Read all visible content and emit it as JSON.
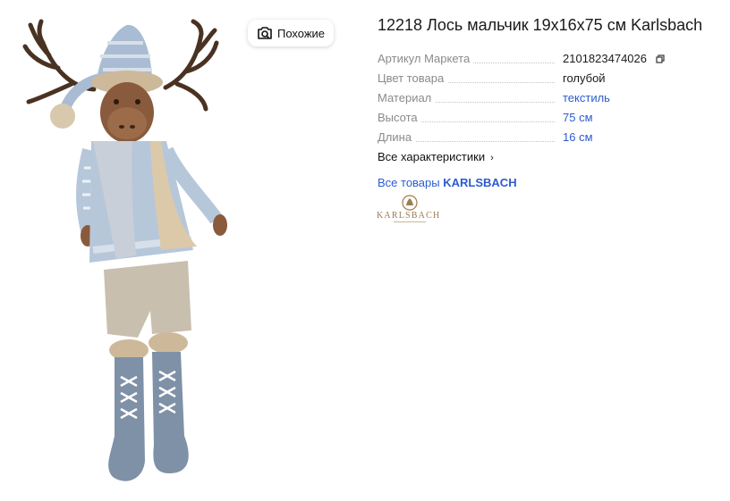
{
  "product": {
    "title": "12218 Лось мальчик 19x16x75 см Karlsbach",
    "image_alt": "moose-boy-toy"
  },
  "similar_button": {
    "label": "Похожие",
    "icon": "camera-search-icon"
  },
  "specs": [
    {
      "name": "Артикул Маркета",
      "value": "2101823474026",
      "link": false,
      "copy": true
    },
    {
      "name": "Цвет товара",
      "value": "голубой",
      "link": false,
      "copy": false
    },
    {
      "name": "Материал",
      "value": "текстиль",
      "link": true,
      "copy": false
    },
    {
      "name": "Высота",
      "value": "75 см",
      "link": true,
      "copy": false
    },
    {
      "name": "Длина",
      "value": "16 см",
      "link": true,
      "copy": false
    }
  ],
  "all_specs": {
    "label": "Все характеристики",
    "icon": "chevron-right-icon"
  },
  "all_goods": {
    "prefix": "Все товары",
    "brand": "KARLSBACH"
  },
  "brand_logo": {
    "text": "KARLSBACH",
    "color": "#9d7c4f"
  },
  "colors": {
    "link": "#2c5bd1",
    "muted": "#8a8a8a"
  }
}
